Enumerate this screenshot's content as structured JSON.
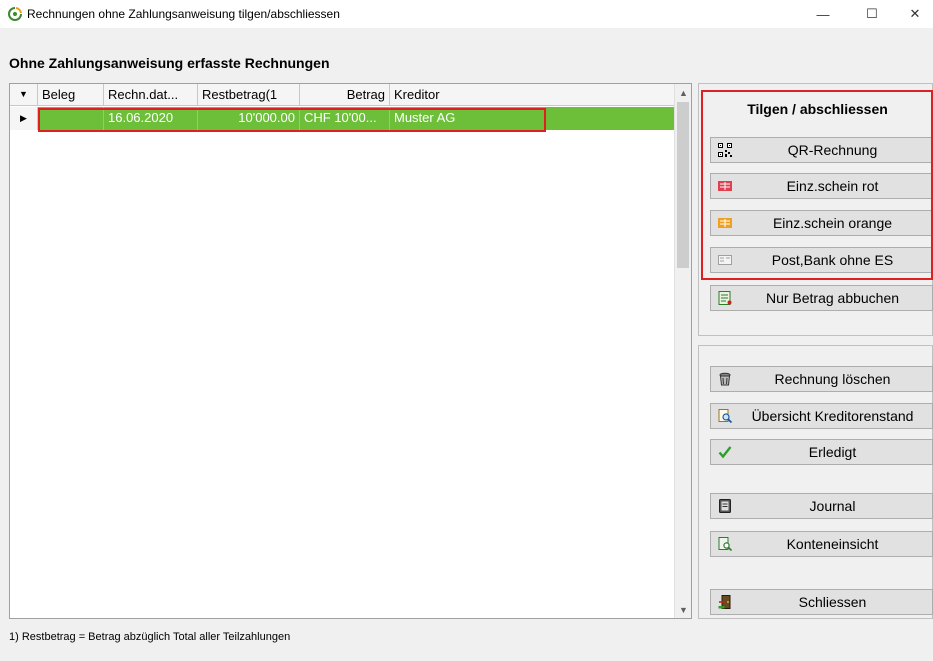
{
  "window": {
    "title": "Rechnungen ohne Zahlungsanweisung tilgen/abschliessen",
    "min_glyph": "—",
    "max_glyph": "☐",
    "close_glyph": "✕"
  },
  "heading": "Ohne Zahlungsanweisung erfasste Rechnungen",
  "grid": {
    "columns": [
      "Beleg",
      "Rechn.dat...",
      "Restbetrag(1",
      "Betrag",
      "Kreditor"
    ],
    "rows": [
      {
        "beleg": "",
        "datum": "16.06.2020",
        "restbetrag": "10'000.00",
        "betrag": "CHF 10'00...",
        "kreditor": "Muster AG"
      }
    ],
    "sort_glyph": "▼",
    "row_pointer_glyph": "▶",
    "scroll_up_glyph": "▲",
    "scroll_down_glyph": "▼"
  },
  "footnote": "1)   Restbetrag = Betrag abzüglich Total aller Teilzahlungen",
  "panel_top": {
    "title": "Tilgen / abschliessen",
    "buttons": [
      {
        "label": "QR-Rechnung",
        "icon": "qr-code-icon"
      },
      {
        "label": "Einz.schein rot",
        "icon": "red-slip-icon"
      },
      {
        "label": "Einz.schein orange",
        "icon": "orange-slip-icon"
      },
      {
        "label": "Post,Bank ohne ES",
        "icon": "grey-slip-icon"
      },
      {
        "label": "Nur Betrag abbuchen",
        "icon": "ledger-icon"
      }
    ]
  },
  "panel_bottom": {
    "buttons": [
      {
        "label": "Rechnung löschen",
        "icon": "trash-icon"
      },
      {
        "label": "Übersicht Kreditorenstand",
        "icon": "magnifier-doc-icon"
      },
      {
        "label": "Erledigt",
        "icon": "checkmark-icon"
      },
      {
        "label": "Journal",
        "icon": "journal-icon"
      },
      {
        "label": "Konteneinsicht",
        "icon": "account-view-icon"
      },
      {
        "label": "Schliessen",
        "icon": "exit-door-icon"
      }
    ]
  },
  "colors": {
    "selection_green": "#6dbf3a",
    "highlight_red": "#e02020",
    "checkmark_green": "#2e9e2e"
  }
}
